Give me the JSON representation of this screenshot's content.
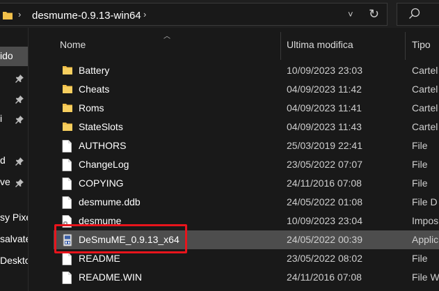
{
  "address": {
    "path": "desmume-0.9.13-win64",
    "chevron": "›",
    "dropdown": "˅",
    "refresh": "↻"
  },
  "nav": {
    "items": [
      {
        "label": "ido",
        "pinned": false
      },
      {
        "label": "",
        "pinned": true
      },
      {
        "label": "",
        "pinned": true
      },
      {
        "label": "i",
        "pinned": true
      },
      {
        "label": "d",
        "pinned": true
      },
      {
        "label": "ve",
        "pinned": true
      },
      {
        "label": "sy Pixe",
        "pinned": false
      },
      {
        "label": "salvate",
        "pinned": false
      },
      {
        "label": "Deskto",
        "pinned": false
      }
    ]
  },
  "header": {
    "name": "Nome",
    "modified": "Ultima modifica",
    "type": "Tipo"
  },
  "files": [
    {
      "name": "Battery",
      "date": "10/09/2023 23:03",
      "type": "Cartel",
      "icon": "folder-icon"
    },
    {
      "name": "Cheats",
      "date": "04/09/2023 11:42",
      "type": "Cartel",
      "icon": "folder-icon"
    },
    {
      "name": "Roms",
      "date": "04/09/2023 11:41",
      "type": "Cartel",
      "icon": "folder-icon"
    },
    {
      "name": "StateSlots",
      "date": "04/09/2023 11:43",
      "type": "Cartel",
      "icon": "folder-icon"
    },
    {
      "name": "AUTHORS",
      "date": "25/03/2019 22:41",
      "type": "File",
      "icon": "file-icon"
    },
    {
      "name": "ChangeLog",
      "date": "23/05/2022 07:07",
      "type": "File",
      "icon": "file-icon"
    },
    {
      "name": "COPYING",
      "date": "24/11/2016 07:08",
      "type": "File",
      "icon": "file-icon"
    },
    {
      "name": "desmume.ddb",
      "date": "24/05/2022 01:08",
      "type": "File D",
      "icon": "file-icon"
    },
    {
      "name": "desmume",
      "date": "10/09/2023 23:04",
      "type": "Impos",
      "icon": "settings-file-icon"
    },
    {
      "name": "DeSmuME_0.9.13_x64",
      "date": "24/05/2022 00:39",
      "type": "Applic",
      "icon": "app-icon",
      "selected": true
    },
    {
      "name": "README",
      "date": "23/05/2022 08:02",
      "type": "File",
      "icon": "file-icon"
    },
    {
      "name": "README.WIN",
      "date": "24/11/2016 07:08",
      "type": "File W",
      "icon": "file-icon"
    }
  ],
  "colors": {
    "highlight_border": "#e8141c",
    "folder": "#f2c04a",
    "selection": "#4d4d4d"
  }
}
